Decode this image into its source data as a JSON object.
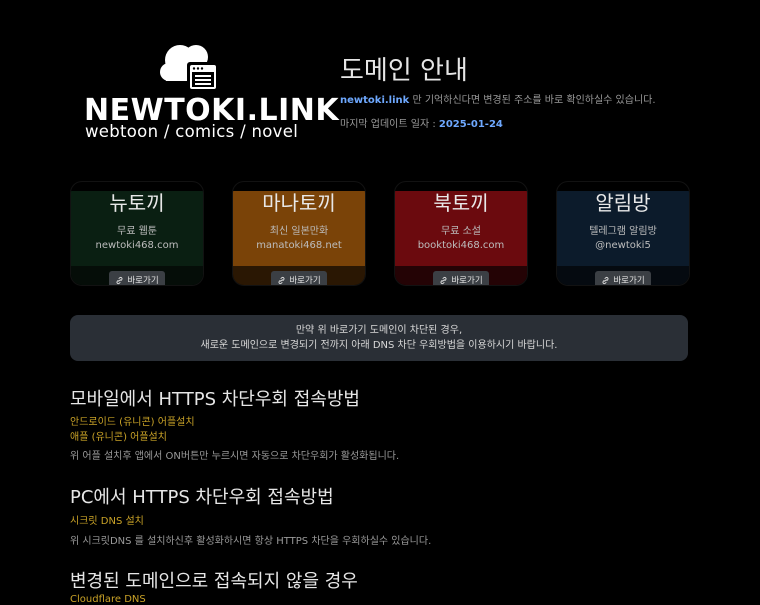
{
  "brand": {
    "name": "NEWTOKI.LINK",
    "tagline": "webtoon / comics / novel"
  },
  "header": {
    "title": "도메인 안내",
    "intro_domain": "newtoki.link",
    "intro_text": " 만 기억하신다면 변경된 주소를 바로 확인하실수 있습니다.",
    "updated_label": "마지막 업데이트 일자 : ",
    "updated_date": "2025-01-24"
  },
  "cards": [
    {
      "title": "뉴토끼",
      "subtitle": "무료 웹툰",
      "url": "newtoki468.com",
      "button": "바로가기",
      "bg_top": "#0a1f12",
      "bg_bottom": "#050d08"
    },
    {
      "title": "마나토끼",
      "subtitle": "최신 일본만화",
      "url": "manatoki468.net",
      "button": "바로가기",
      "bg_top": "#7a4308",
      "bg_bottom": "#2a1703"
    },
    {
      "title": "북토끼",
      "subtitle": "무료 소설",
      "url": "booktoki468.com",
      "button": "바로가기",
      "bg_top": "#6b0a0e",
      "bg_bottom": "#240305"
    },
    {
      "title": "알림방",
      "subtitle": "텔레그램 알림방",
      "url": "@newtoki5",
      "button": "바로가기",
      "bg_top": "#0c1b2b",
      "bg_bottom": "#050a10"
    }
  ],
  "notice": {
    "line1": "만약 위 바로가기 도메인이 차단된 경우,",
    "line2": "새로운 도메인으로 변경되기 전까지 아래 DNS 차단 우회방법을 이용하시기 바랍니다."
  },
  "sections": {
    "mobile": {
      "title": "모바일에서 HTTPS 차단우회 접속방법",
      "link1": "안드로이드 (유니콘) 어플설치",
      "link2": "애플 (유니콘) 어플설치",
      "desc": "위 어플 설치후 앱에서 ON버튼만 누르시면 자동으로 차단우회가 활성화됩니다."
    },
    "pc": {
      "title": "PC에서 HTTPS 차단우회 접속방법",
      "link1": "시크릿 DNS 설치",
      "desc": "위 시크릿DNS 를 설치하신후 활성화하시면 항상 HTTPS 차단을 우회하실수 있습니다."
    },
    "fallback": {
      "title": "변경된 도메인으로 접속되지 않을 경우",
      "link1": "Cloudflare DNS"
    }
  }
}
